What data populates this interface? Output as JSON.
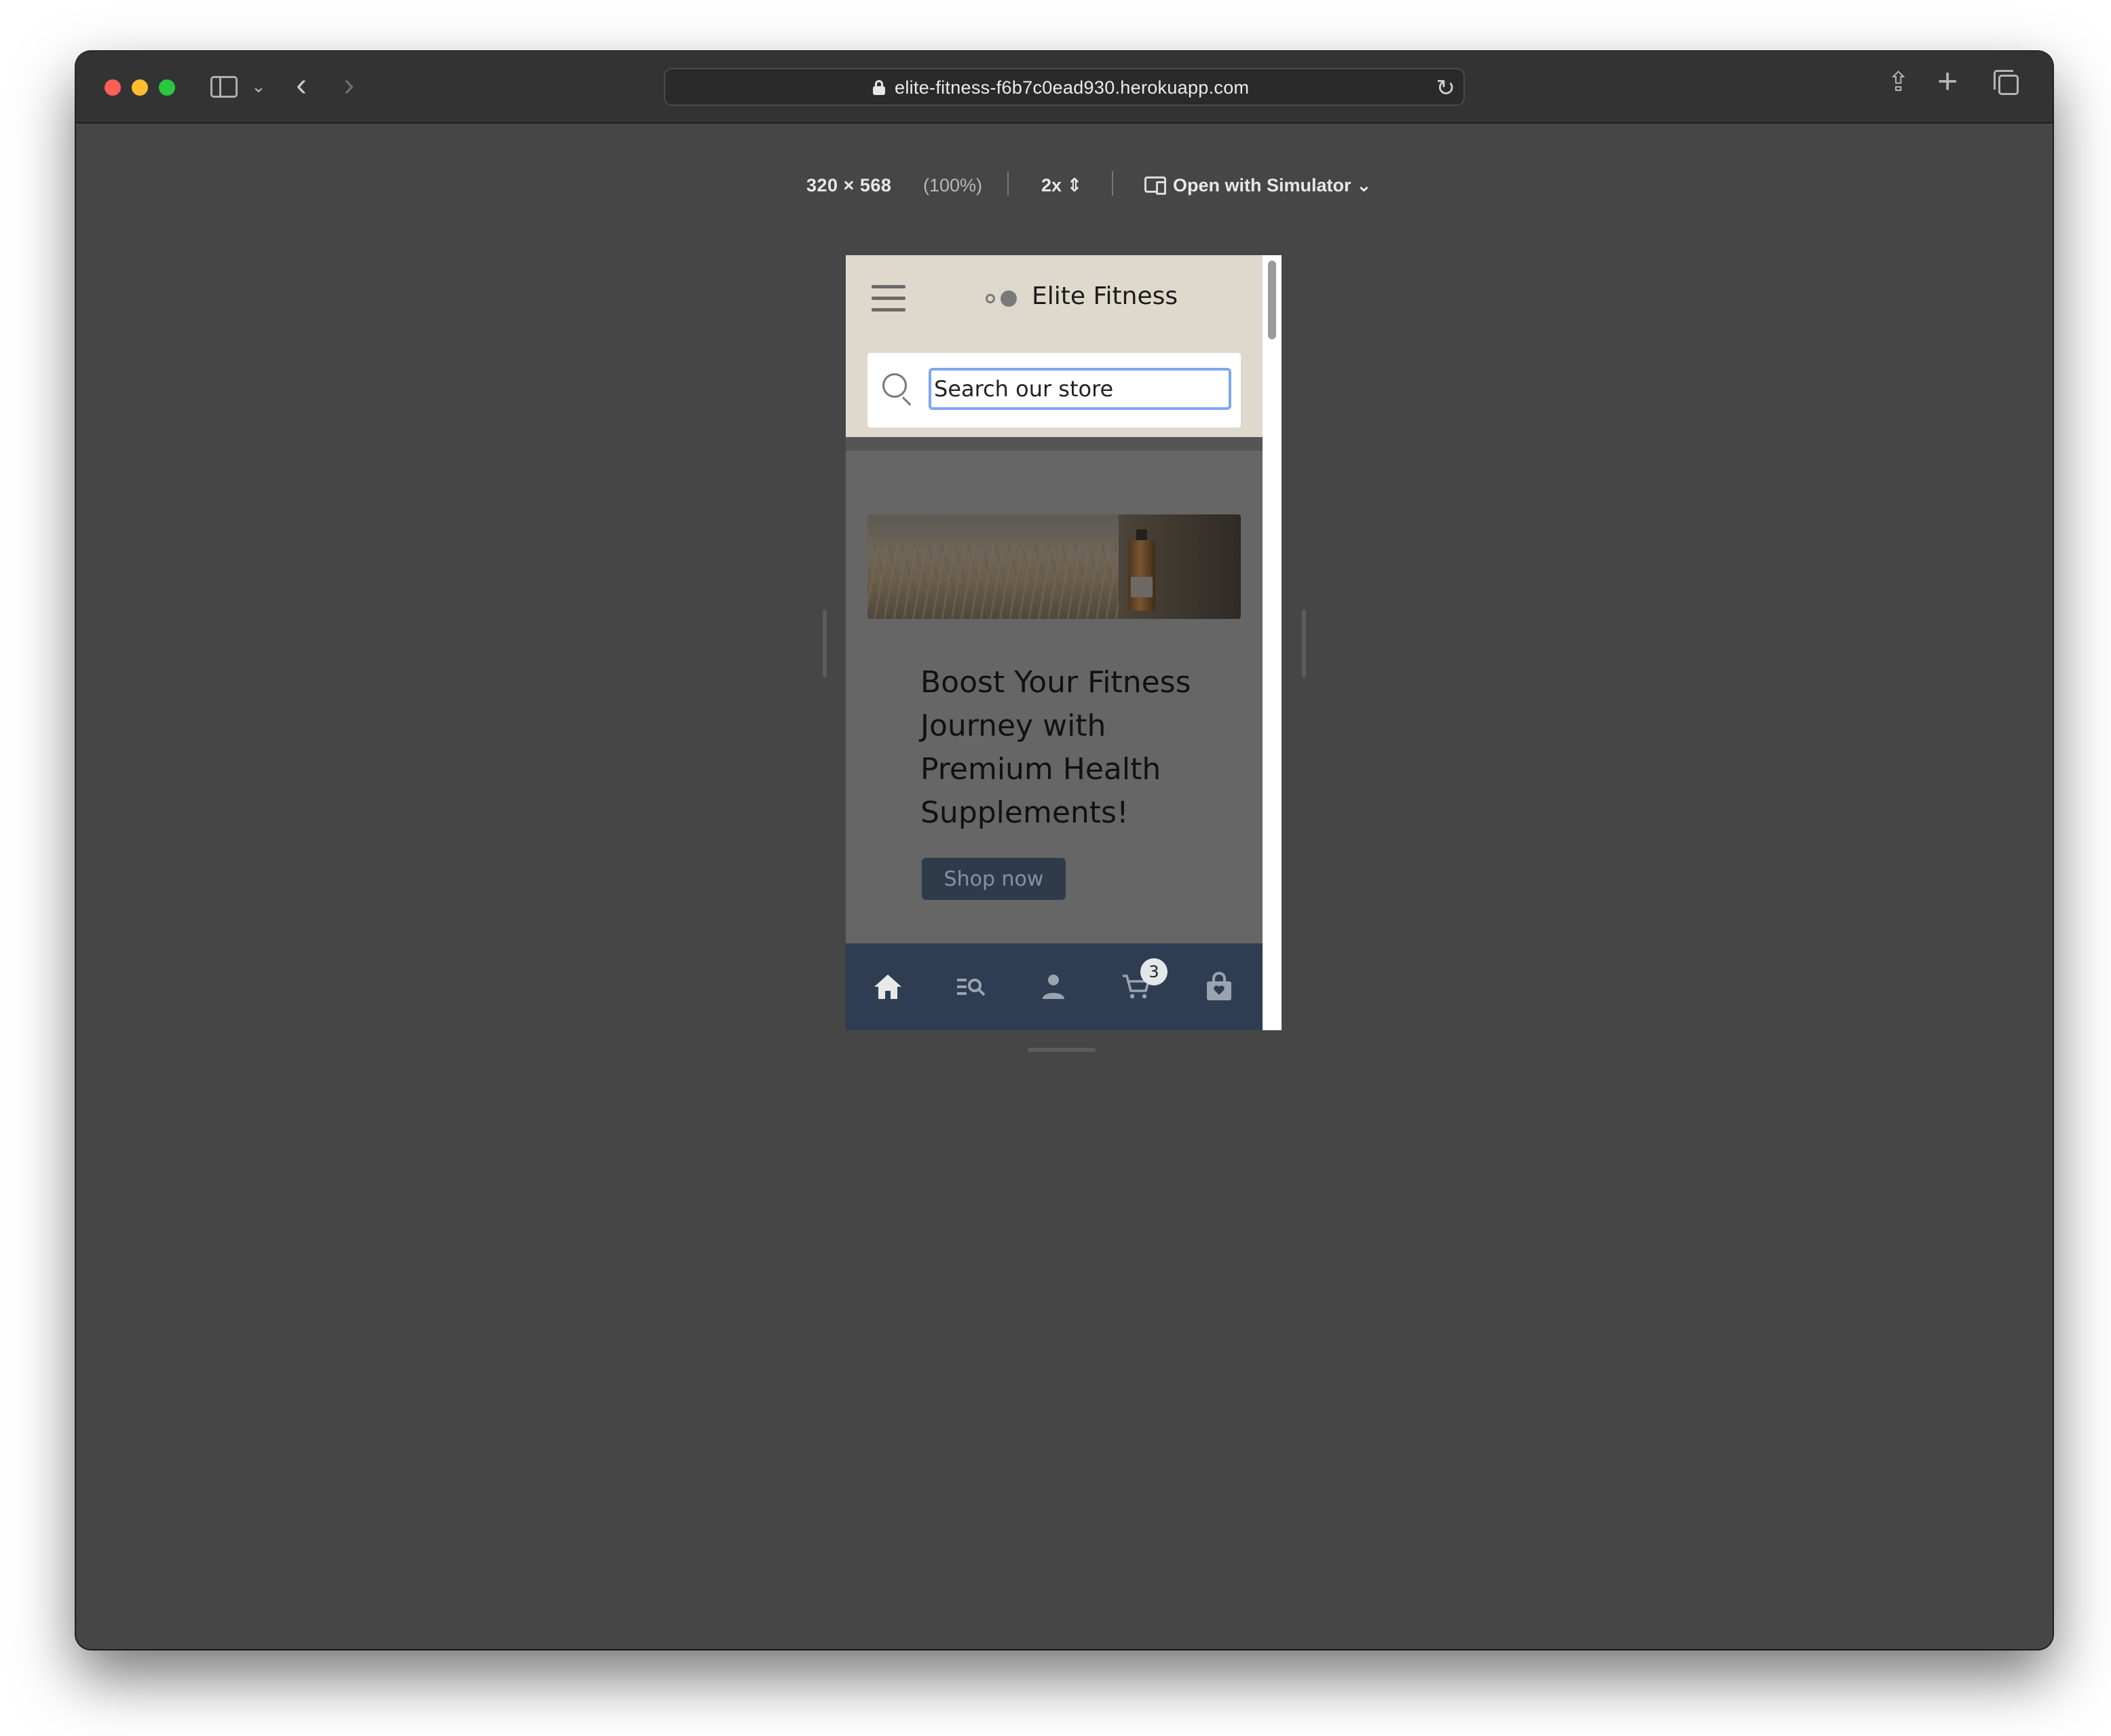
{
  "browser": {
    "url": "elite-fitness-f6b7c0ead930.herokuapp.com",
    "nav_back_glyph": "‹",
    "nav_forward_glyph": "›",
    "reload_glyph": "↻",
    "share_glyph": "⇪",
    "new_tab_glyph": "+"
  },
  "responsive_toolbar": {
    "dimensions": "320 × 568",
    "zoom": "(100%)",
    "pixel_ratio": "2x ⇕",
    "simulator_label": "Open with Simulator ⌄"
  },
  "site": {
    "brand": "Elite Fitness",
    "search": {
      "placeholder": "Search our store"
    },
    "hero": {
      "title": "Boost Your Fitness Journey with Premium Health Supplements!",
      "cta_label": "Shop now"
    },
    "bottom_nav": {
      "items": [
        "home-icon",
        "search-list-icon",
        "user-icon",
        "cart-icon",
        "shopping-bag-icon"
      ],
      "cart_count": "3"
    }
  },
  "colors": {
    "header_bg": "#ded9cc",
    "overlay_bg": "#666666",
    "bottom_nav_bg": "#2e3d52",
    "cta_bg": "#2f3b4b",
    "focus_ring": "#7ea6f2"
  }
}
